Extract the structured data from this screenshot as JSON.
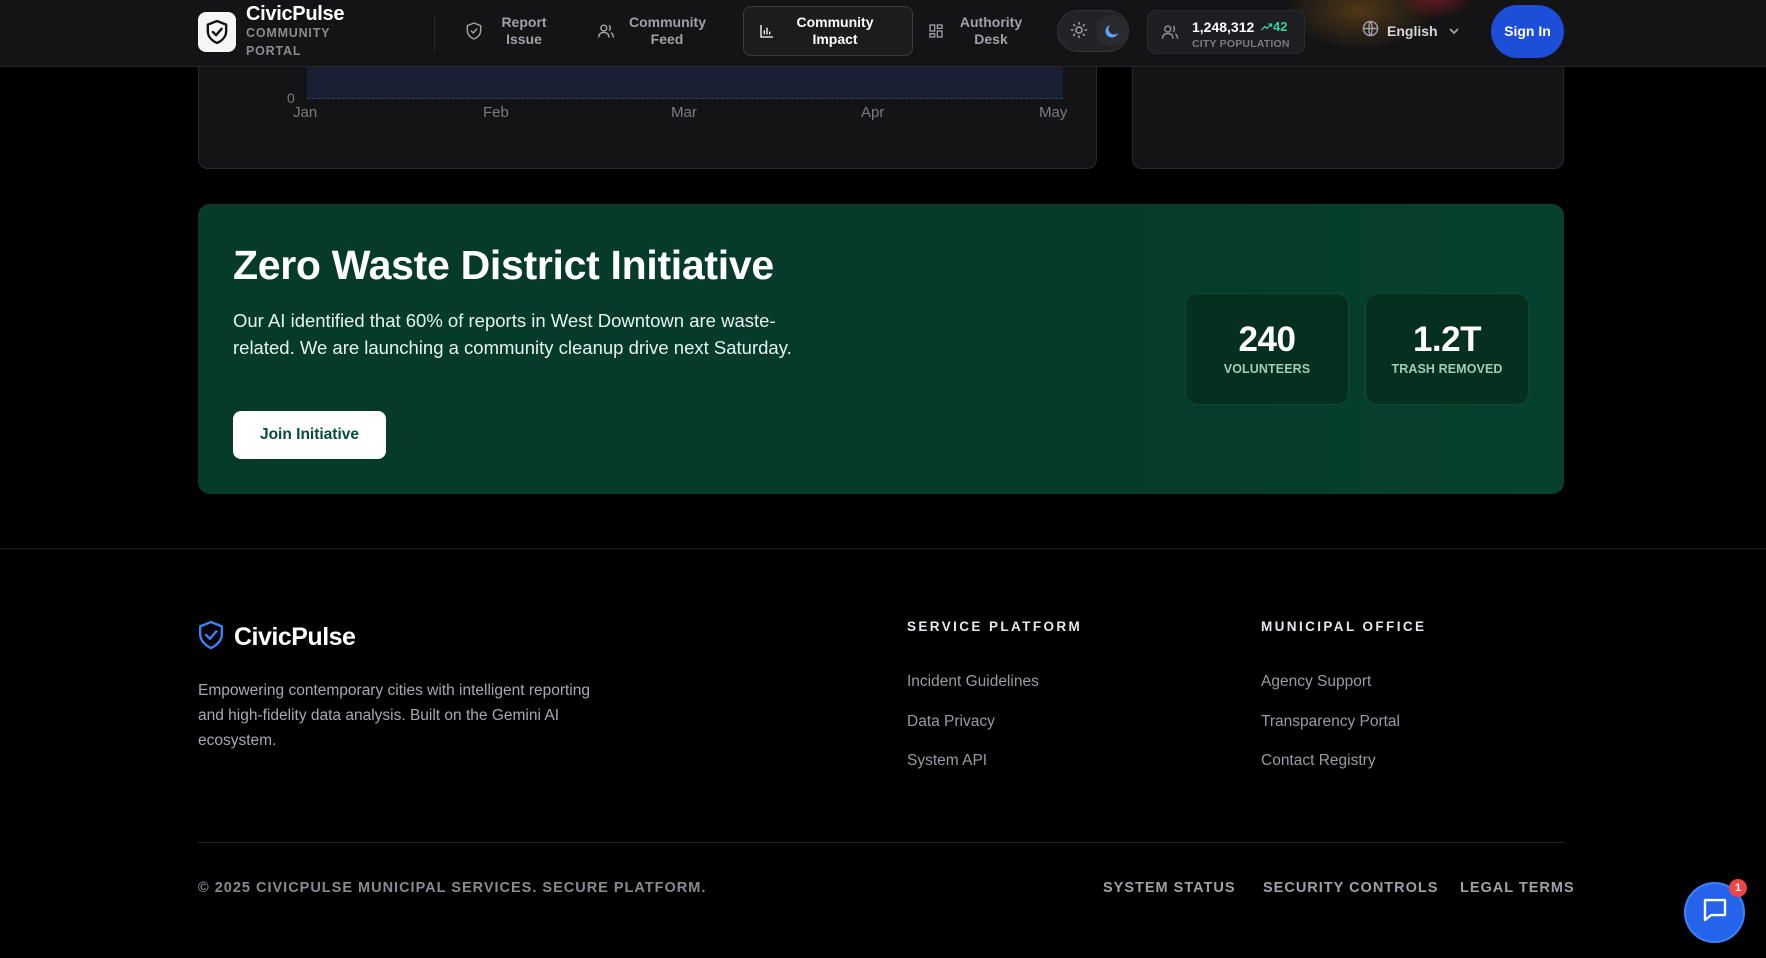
{
  "nav": {
    "brand_name": "CivicPulse",
    "brand_sub": "COMMUNITY PORTAL",
    "items": [
      {
        "label": "Report Issue",
        "icon": "shield-icon",
        "active": false
      },
      {
        "label": "Community Feed",
        "icon": "users-icon",
        "active": false
      },
      {
        "label": "Community Impact",
        "icon": "bar-chart-icon",
        "active": true
      },
      {
        "label": "Authority Desk",
        "icon": "dashboard-icon",
        "active": false
      }
    ],
    "population": {
      "value": "1,248,312",
      "delta": "42",
      "label": "CITY POPULATION"
    },
    "language": "English",
    "signin": "Sign In"
  },
  "chart_data": {
    "type": "area",
    "categories": [
      "Jan",
      "Feb",
      "Mar",
      "Apr",
      "May"
    ],
    "y_ticks": [
      "0"
    ],
    "title": "",
    "xlabel": "",
    "ylabel": ""
  },
  "initiative": {
    "title": "Zero Waste District Initiative",
    "description": "Our AI identified that 60% of reports in West Downtown are waste-related. We are launching a community cleanup drive next Saturday.",
    "button": "Join Initiative",
    "stats": [
      {
        "value": "240",
        "label": "VOLUNTEERS"
      },
      {
        "value": "1.2T",
        "label": "TRASH REMOVED"
      }
    ]
  },
  "footer": {
    "brand_name": "CivicPulse",
    "description": "Empowering contemporary cities with intelligent reporting and high-fidelity data analysis. Built on the Gemini AI ecosystem.",
    "columns": [
      {
        "title": "SERVICE PLATFORM",
        "links": [
          "Incident Guidelines",
          "Data Privacy",
          "System API"
        ]
      },
      {
        "title": "MUNICIPAL OFFICE",
        "links": [
          "Agency Support",
          "Transparency Portal",
          "Contact Registry"
        ]
      }
    ],
    "copyright": "© 2025 CIVICPULSE MUNICIPAL SERVICES. SECURE PLATFORM.",
    "bottom_links": [
      "SYSTEM STATUS",
      "SECURITY CONTROLS",
      "LEGAL TERMS"
    ]
  },
  "chat": {
    "badge": "1",
    "icon": "chat-icon"
  },
  "colors": {
    "accent": "#1d4ed8",
    "banner": "#063b2a",
    "positive": "#34d399",
    "badge": "#ef4444"
  }
}
